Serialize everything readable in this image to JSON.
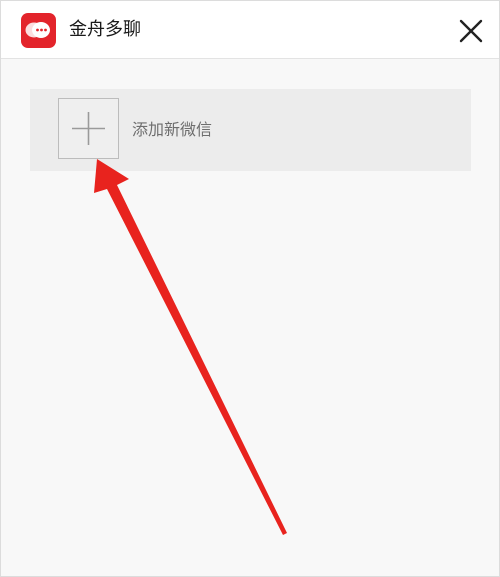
{
  "window": {
    "title": "金舟多聊",
    "logo_icon": "chat-bubble-icon",
    "close_icon": "close-icon"
  },
  "main": {
    "add_wechat": {
      "label": "添加新微信",
      "icon": "plus-icon"
    }
  },
  "colors": {
    "brand_red": "#e3242b",
    "annotation_arrow": "#e8231e",
    "card_bg": "#ececec",
    "window_bg": "#f8f8f8"
  }
}
